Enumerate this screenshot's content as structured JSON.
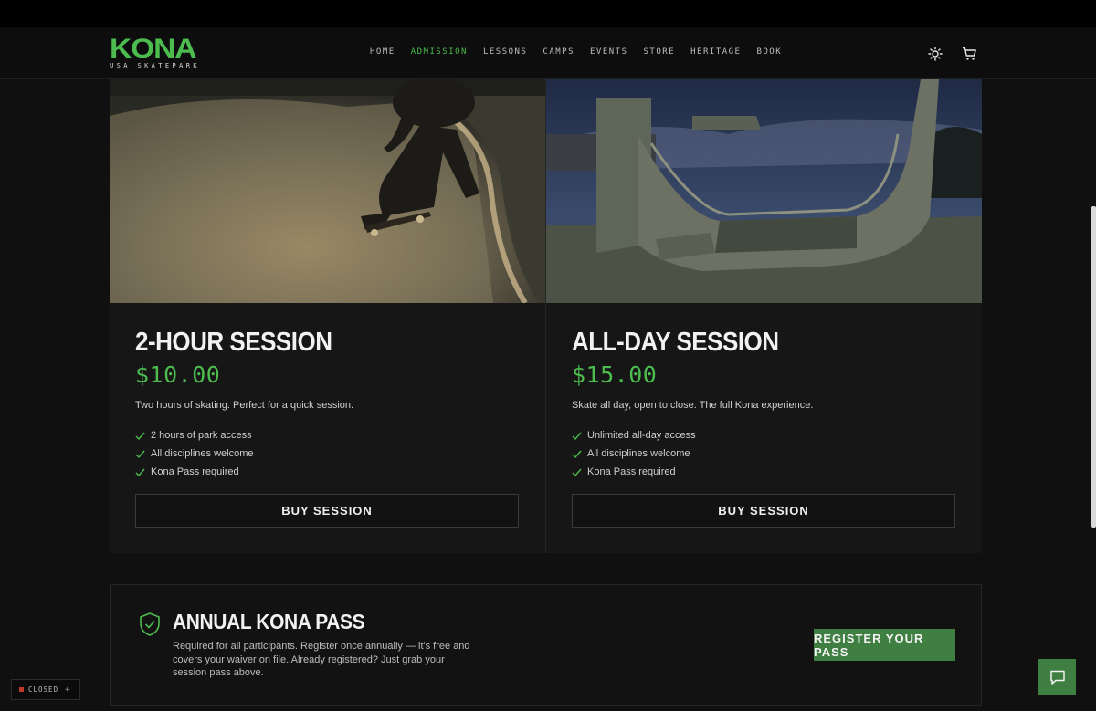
{
  "brand": {
    "name": "KONA",
    "tagline": "USA SKATEPARK"
  },
  "nav": {
    "items": [
      {
        "label": "HOME",
        "active": false
      },
      {
        "label": "ADMISSION",
        "active": true
      },
      {
        "label": "LESSONS",
        "active": false
      },
      {
        "label": "CAMPS",
        "active": false
      },
      {
        "label": "EVENTS",
        "active": false
      },
      {
        "label": "STORE",
        "active": false
      },
      {
        "label": "HERITAGE",
        "active": false
      },
      {
        "label": "BOOK",
        "active": false
      }
    ],
    "theme_icon": "sun-icon",
    "cart_icon": "cart-icon"
  },
  "sessions": [
    {
      "title": "2-Hour Session",
      "price": "$10.00",
      "description": "Two hours of skating. Perfect for a quick session.",
      "features": [
        "2 hours of park access",
        "All disciplines welcome",
        "Kona Pass required"
      ],
      "button": "Buy Session"
    },
    {
      "title": "All-Day Session",
      "price": "$15.00",
      "description": "Skate all day, open to close. The full Kona experience.",
      "features": [
        "Unlimited all-day access",
        "All disciplines welcome",
        "Kona Pass required"
      ],
      "button": "Buy Session"
    }
  ],
  "pass": {
    "icon": "shield-check-icon",
    "title": "Annual Kona Pass",
    "description": "Required for all participants. Register once annually — it's free and covers your waiver on file. Already registered? Just grab your session pass above.",
    "button": "Register Your Pass"
  },
  "status": {
    "label": "CLOSED",
    "color": "#c0392b"
  },
  "chat": {
    "icon": "chat-bubble-icon"
  },
  "colors": {
    "accent": "#4cbc4f",
    "button_green": "#3f7f41",
    "background": "#101010",
    "card": "#161616"
  }
}
